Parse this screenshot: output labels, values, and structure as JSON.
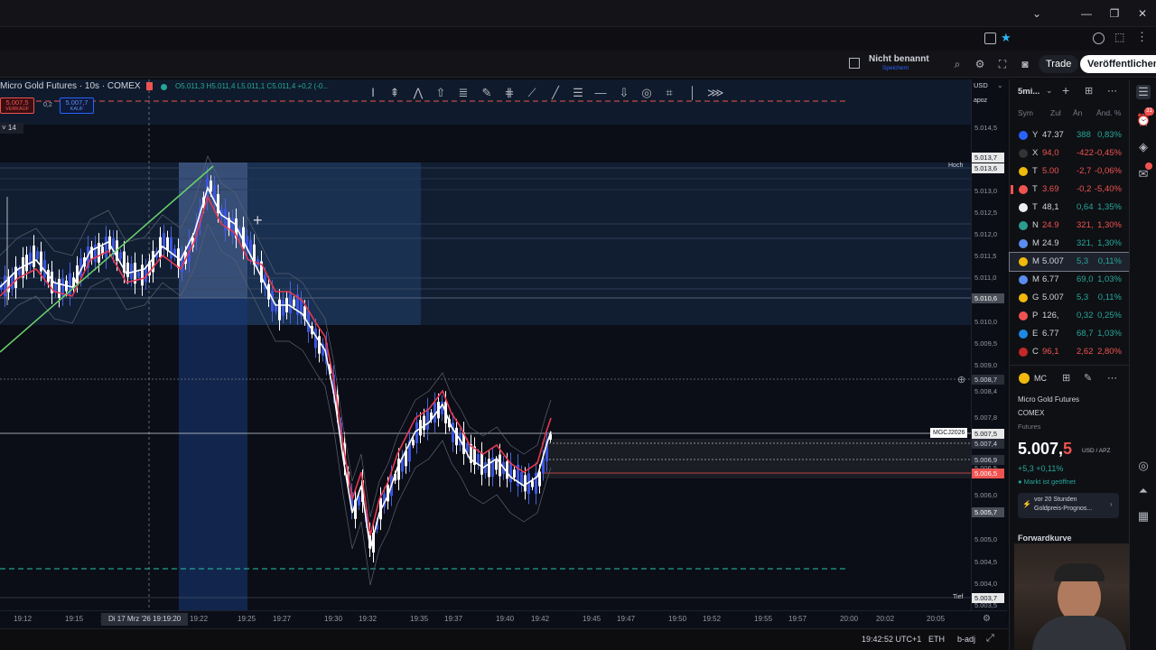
{
  "header": {
    "layout_name": "Nicht benannt",
    "layout_sub": "Speichern",
    "trade_label": "Trade",
    "publish_label": "Veröffentlichen"
  },
  "symbol": {
    "title": "Micro Gold Futures · 10s · COMEX",
    "ohlc": "O5.011,3 H5.011,4 L5.011,1 C5.011,4 +0,2 (-0...",
    "sell_price": "5.007,5",
    "sell_label": "VERKAUF",
    "spread": "0,2",
    "buy_price": "5.007,7",
    "buy_label": "KAUF",
    "indicator_value": "14"
  },
  "price_axis": {
    "currency": "USD",
    "unit": "apoz",
    "ticks": [
      "5.014,5",
      "5.013,0",
      "5.012,5",
      "5.012,0",
      "5.011,5",
      "5.011,0",
      "5.010,5",
      "5.010,0",
      "5.009,5",
      "5.009,0",
      "5.008,4",
      "5.007,8",
      "5.006,5",
      "5.006,0",
      "5.005,0",
      "5.004,5",
      "5.004,0",
      "5.003,5"
    ],
    "tags": [
      {
        "text": "5.013,7",
        "kind": "white"
      },
      {
        "text": "5.013,6",
        "kind": "white"
      },
      {
        "text": "5.010,6",
        "kind": "gray"
      },
      {
        "text": "5.008,7",
        "kind": "dark"
      },
      {
        "text": "5.007,5",
        "kind": "white"
      },
      {
        "text": "5.007,4",
        "kind": "dark"
      },
      {
        "text": "5.006,9",
        "kind": "dark"
      },
      {
        "text": "5.006,5",
        "kind": "red"
      },
      {
        "text": "5.005,7",
        "kind": "gray"
      },
      {
        "text": "5.003,7",
        "kind": "white"
      }
    ],
    "hoch_label": "Hoch",
    "tief_label": "Tief",
    "symbol_tag": "MGCJ2026"
  },
  "time_axis": {
    "labels": [
      "19:12",
      "19:15",
      "19:17",
      "19:20",
      "19:22",
      "19:25",
      "19:27",
      "19:30",
      "19:32",
      "19:35",
      "19:37",
      "19:40",
      "19:42",
      "19:45",
      "19:47",
      "19:50",
      "19:52",
      "19:55",
      "19:57",
      "20:00",
      "20:02",
      "20:05"
    ],
    "cursor_label": "Di 17 Mrz '26  19:19:20"
  },
  "status": {
    "time": "19:42:52 UTC+1",
    "session": "ETH",
    "adj": "b-adj"
  },
  "watchlist": {
    "interval": "5mi...",
    "columns": [
      "Sym",
      "Zul",
      "Än",
      "Änd. %"
    ],
    "rows": [
      {
        "sym": "Y",
        "last": "47.37",
        "chg": "388",
        "pct": "0,83%",
        "up": true,
        "color": "#2962ff"
      },
      {
        "sym": "X",
        "last": "94,0",
        "chg": "-422",
        "pct": "-0,45%",
        "up": false,
        "color": "#333"
      },
      {
        "sym": "T",
        "last": "5.00",
        "chg": "-2,7",
        "pct": "-0,06%",
        "up": false,
        "color": "#f0b90b"
      },
      {
        "sym": "T",
        "last": "3.69",
        "chg": "-0,2",
        "pct": "-5,40%",
        "up": false,
        "color": "#ef5350"
      },
      {
        "sym": "T",
        "last": "48,1",
        "chg": "0,64",
        "pct": "1,35%",
        "up": true,
        "color": "#eee"
      },
      {
        "sym": "N",
        "last": "24.9",
        "chg": "321,",
        "pct": "1,30%",
        "up": false,
        "color": "#2a9d8f"
      },
      {
        "sym": "M",
        "last": "24.9",
        "chg": "321,",
        "pct": "1,30%",
        "up": true,
        "color": "#5b8def"
      },
      {
        "sym": "M",
        "last": "5.007",
        "chg": "5,3",
        "pct": "0,11%",
        "up": true,
        "color": "#f0b90b"
      },
      {
        "sym": "M",
        "last": "6.77",
        "chg": "69,0",
        "pct": "1,03%",
        "up": true,
        "color": "#5b8def"
      },
      {
        "sym": "G",
        "last": "5.007",
        "chg": "5,3",
        "pct": "0,11%",
        "up": true,
        "color": "#f0b90b"
      },
      {
        "sym": "P",
        "last": "126,",
        "chg": "0,32",
        "pct": "0,25%",
        "up": true,
        "color": "#ef5350"
      },
      {
        "sym": "E",
        "last": "6.77",
        "chg": "68,7",
        "pct": "1,03%",
        "up": true,
        "color": "#1e88e5"
      },
      {
        "sym": "C",
        "last": "96,1",
        "chg": "2,62",
        "pct": "2,80%",
        "up": false,
        "color": "#c62828"
      }
    ],
    "selected_index": 7
  },
  "details": {
    "symbol_short": "MC",
    "name": "Micro Gold Futures",
    "exchange": "COMEX",
    "type": "Futures",
    "price_main": "5.007,",
    "price_last": "5",
    "currency": "USD / APZ",
    "change": "+5,3 +0,11%",
    "market_status": "Markt ist geöffnet",
    "news_time": "vor 20 Stunden",
    "news_title": "Goldpreis-Prognos...",
    "forward_label": "Forwardkurve"
  },
  "colors": {
    "up": "#26a69a",
    "down": "#ef5350",
    "accent": "#2962ff",
    "ema": "#e53950",
    "trend": "#6bd46b"
  }
}
